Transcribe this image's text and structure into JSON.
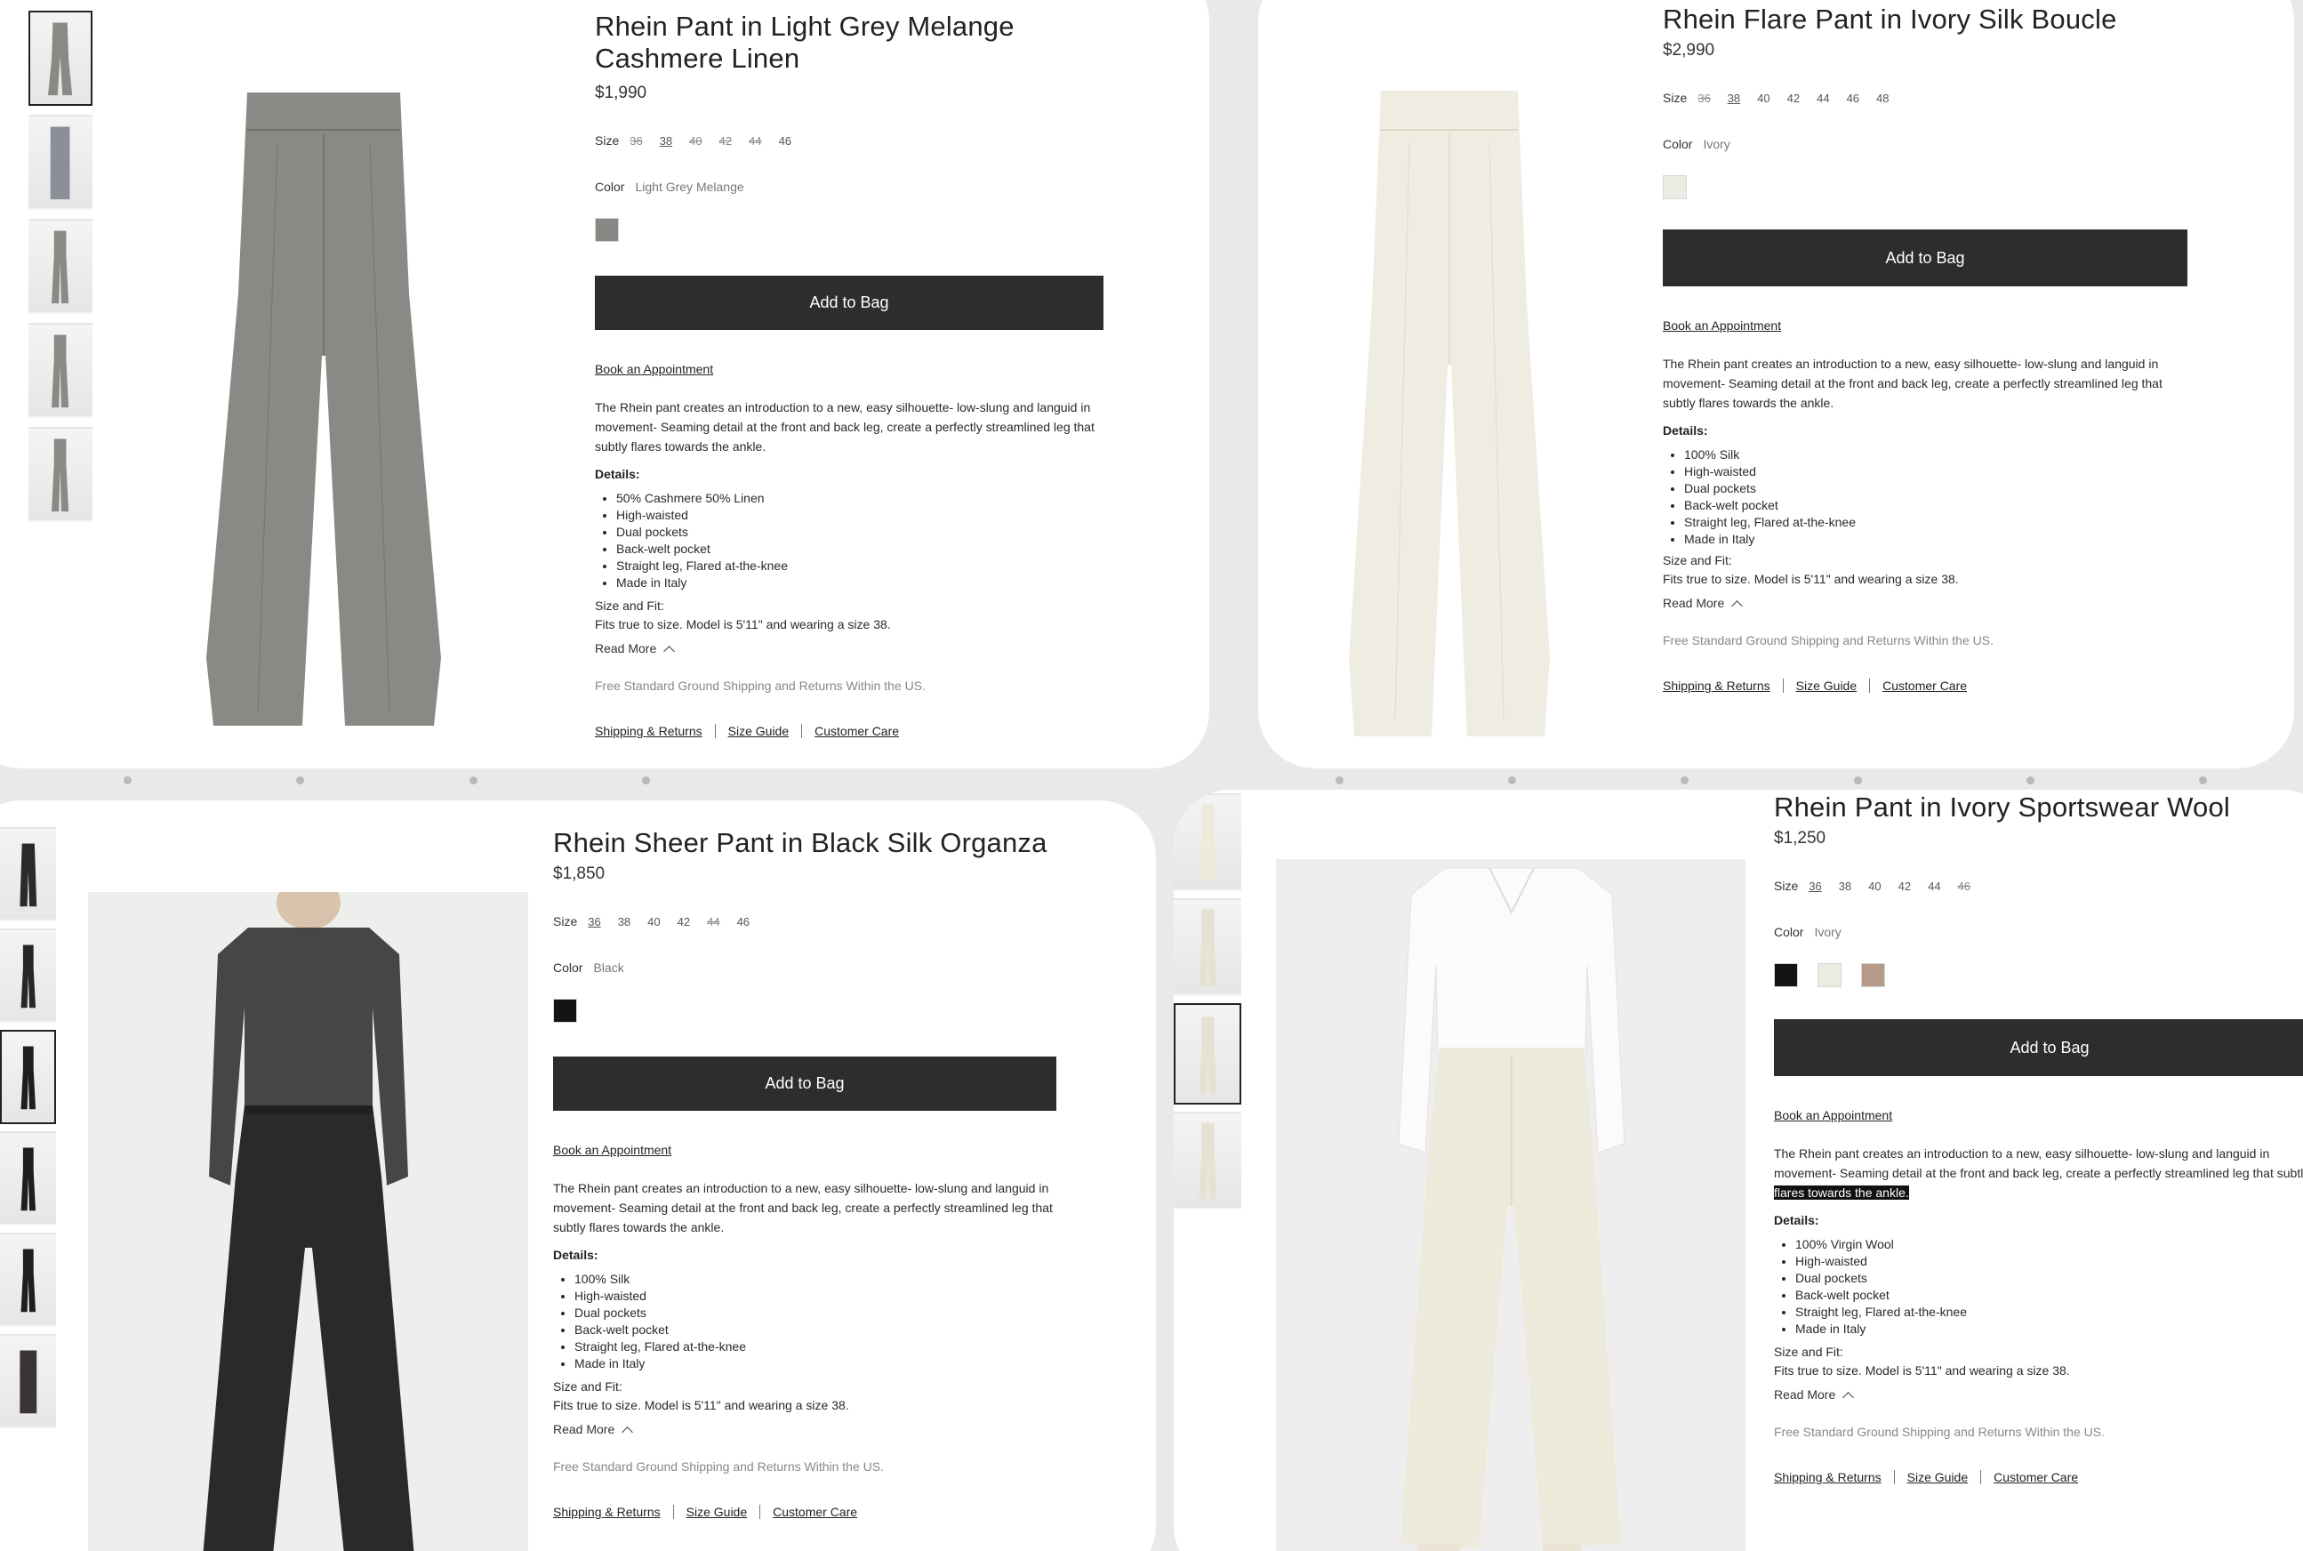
{
  "common": {
    "size_label": "Size",
    "color_label": "Color",
    "add_to_bag": "Add to Bag",
    "book_appointment": "Book an Appointment",
    "description": "The Rhein pant creates an introduction to a new, easy silhouette- low-slung and languid in movement- Seaming detail at the front and back leg, create a perfectly streamlined leg that subtly flares towards the ankle.",
    "details_heading": "Details:",
    "size_fit_heading": "Size and Fit:",
    "size_fit_text": "Fits true to size. Model is 5'11\" and wearing a size 38.",
    "read_more": "Read More",
    "shipping_note": "Free Standard Ground Shipping and Returns Within the US.",
    "footer_links": [
      "Shipping & Returns",
      "Size Guide",
      "Customer Care"
    ]
  },
  "products": [
    {
      "title": "Rhein Pant in Light Grey Melange Cashmere Linen",
      "price": "$1,990",
      "sizes": [
        {
          "label": "36",
          "state": "out"
        },
        {
          "label": "38",
          "state": "selected"
        },
        {
          "label": "40",
          "state": "out"
        },
        {
          "label": "42",
          "state": "out"
        },
        {
          "label": "44",
          "state": "out"
        },
        {
          "label": "46",
          "state": "available"
        }
      ],
      "color": "Light Grey Melange",
      "swatches": [
        "#8a8884"
      ],
      "details": [
        "50% Cashmere 50% Linen",
        "High-waisted",
        "Dual pockets",
        "Back-welt pocket",
        "Straight leg, Flared at-the-knee",
        "Made in Italy"
      ],
      "garment_color": "#8b8985"
    },
    {
      "title": "Rhein Flare Pant in Ivory Silk Boucle",
      "price": "$2,990",
      "sizes": [
        {
          "label": "36",
          "state": "out"
        },
        {
          "label": "38",
          "state": "selected"
        },
        {
          "label": "40",
          "state": "available"
        },
        {
          "label": "42",
          "state": "available"
        },
        {
          "label": "44",
          "state": "available"
        },
        {
          "label": "46",
          "state": "available"
        },
        {
          "label": "48",
          "state": "available"
        }
      ],
      "color": "Ivory",
      "swatches": [
        "#ecebe4"
      ],
      "details": [
        "100% Silk",
        "High-waisted",
        "Dual pockets",
        "Back-welt pocket",
        "Straight leg, Flared at-the-knee",
        "Made in Italy"
      ],
      "garment_color": "#efece1"
    },
    {
      "title": "Rhein Sheer Pant in Black Silk Organza",
      "price": "$1,850",
      "sizes": [
        {
          "label": "36",
          "state": "selected"
        },
        {
          "label": "38",
          "state": "available"
        },
        {
          "label": "40",
          "state": "available"
        },
        {
          "label": "42",
          "state": "available"
        },
        {
          "label": "44",
          "state": "out"
        },
        {
          "label": "46",
          "state": "available"
        }
      ],
      "color": "Black",
      "swatches": [
        "#141414"
      ],
      "details": [
        "100% Silk",
        "High-waisted",
        "Dual pockets",
        "Back-welt pocket",
        "Straight leg, Flared at-the-knee",
        "Made in Italy"
      ],
      "garment_color": "#1f1d1d"
    },
    {
      "title": "Rhein Pant in Ivory Sportswear Wool",
      "price": "$1,250",
      "sizes": [
        {
          "label": "36",
          "state": "selected"
        },
        {
          "label": "38",
          "state": "available"
        },
        {
          "label": "40",
          "state": "available"
        },
        {
          "label": "42",
          "state": "available"
        },
        {
          "label": "44",
          "state": "available"
        },
        {
          "label": "46",
          "state": "out"
        }
      ],
      "color": "Ivory",
      "swatches": [
        "#141414",
        "#ecebe2",
        "#b59a89"
      ],
      "details": [
        "100% Virgin Wool",
        "High-waisted",
        "Dual pockets",
        "Back-welt pocket",
        "Straight leg, Flared at-the-knee",
        "Made in Italy"
      ],
      "garment_color": "#eeeadb",
      "highlighted_text": "flares towards the ankle."
    }
  ]
}
